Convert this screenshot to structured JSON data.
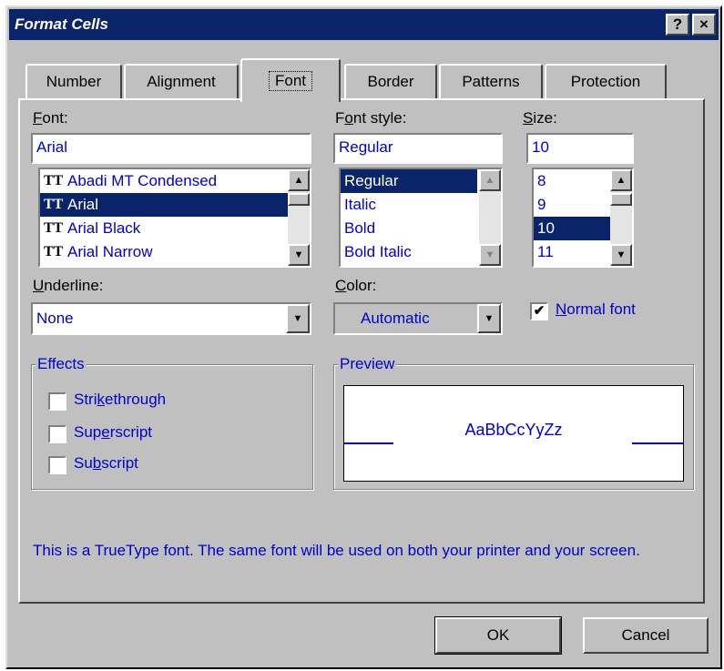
{
  "window": {
    "title": "Format Cells",
    "help_button": "?",
    "close_button": "×"
  },
  "tabs": [
    {
      "label": "Number"
    },
    {
      "label": "Alignment"
    },
    {
      "label": "Font"
    },
    {
      "label": "Border"
    },
    {
      "label": "Patterns"
    },
    {
      "label": "Protection"
    }
  ],
  "font": {
    "label_pre": "",
    "label_key": "F",
    "label_post": "ont:",
    "value": "Arial",
    "items": [
      "Abadi MT Condensed",
      "Arial",
      "Arial Black",
      "Arial Narrow"
    ],
    "selected": "Arial"
  },
  "font_style": {
    "label_pre": "F",
    "label_key": "o",
    "label_post": "nt style:",
    "value": "Regular",
    "items": [
      "Regular",
      "Italic",
      "Bold",
      "Bold Italic"
    ],
    "selected": "Regular"
  },
  "size": {
    "label_pre": "",
    "label_key": "S",
    "label_post": "ize:",
    "value": "10",
    "items": [
      "8",
      "9",
      "10",
      "11"
    ],
    "selected": "10"
  },
  "underline": {
    "label_pre": "",
    "label_key": "U",
    "label_post": "nderline:",
    "value": "None"
  },
  "color": {
    "label_pre": "",
    "label_key": "C",
    "label_post": "olor:",
    "value": "Automatic"
  },
  "normal_font": {
    "label_pre": "",
    "label_key": "N",
    "label_post": "ormal font",
    "checked": true,
    "check_glyph": "✔"
  },
  "effects": {
    "title": "Effects",
    "items": [
      {
        "pre": "Stri",
        "key": "k",
        "post": "ethrough",
        "checked": false
      },
      {
        "pre": "Sup",
        "key": "e",
        "post": "rscript",
        "checked": false
      },
      {
        "pre": "Su",
        "key": "b",
        "post": "script",
        "checked": false
      }
    ]
  },
  "preview": {
    "title": "Preview",
    "sample": "AaBbCcYyZz"
  },
  "info_text": "This is a TrueType font.  The same font will be used on both your printer and your screen.",
  "buttons": {
    "ok": "OK",
    "cancel": "Cancel"
  },
  "icons": {
    "truetype": "TT",
    "arrow_up": "▲",
    "arrow_down": "▼"
  },
  "colors": {
    "title_bar": "#0a246a",
    "face": "#c0c0c0",
    "text_blue": "#0000cc"
  }
}
